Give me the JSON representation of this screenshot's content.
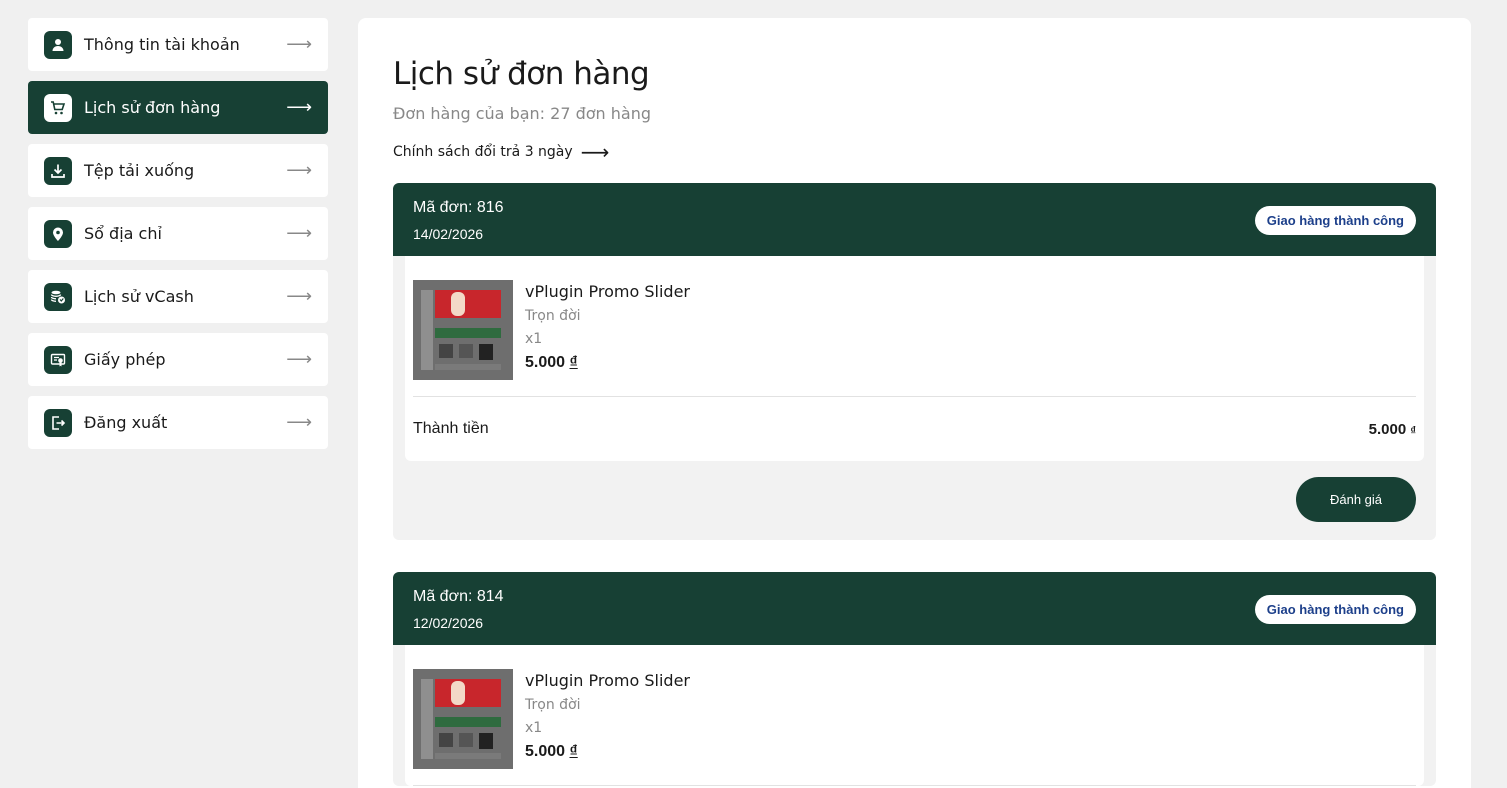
{
  "sidebar": {
    "items": [
      {
        "label": "Thông tin tài khoản",
        "icon": "user-icon",
        "arrow": "⟶"
      },
      {
        "label": "Lịch sử đơn hàng",
        "icon": "cart-icon",
        "arrow": "⟶",
        "active": true
      },
      {
        "label": "Tệp tải xuống",
        "icon": "download-icon",
        "arrow": "⟶"
      },
      {
        "label": "Sổ địa chỉ",
        "icon": "location-pin-icon",
        "arrow": "⟶"
      },
      {
        "label": "Lịch sử vCash",
        "icon": "coins-icon",
        "arrow": "⟶"
      },
      {
        "label": "Giấy phép",
        "icon": "certificate-icon",
        "arrow": "⟶"
      },
      {
        "label": "Đăng xuất",
        "icon": "logout-icon",
        "arrow": "⟶"
      }
    ]
  },
  "main": {
    "title": "Lịch sử đơn hàng",
    "order_count": "Đơn hàng của bạn: 27 đơn hàng",
    "policy_link": "Chính sách đổi trả 3 ngày",
    "policy_arrow": "⟶",
    "orders": [
      {
        "code": "Mã đơn: 816",
        "date": "14/02/2026",
        "status": "Giao hàng thành công",
        "product": {
          "name": "vPlugin Promo Slider",
          "duration": "Trọn đời",
          "qty": "x1",
          "price": "5.000",
          "currency": "₫"
        },
        "total_label": "Thành tiền",
        "total_value": "5.000",
        "total_currency": "₫",
        "review_button": "Đánh giá"
      },
      {
        "code": "Mã đơn: 814",
        "date": "12/02/2026",
        "status": "Giao hàng thành công",
        "product": {
          "name": "vPlugin Promo Slider",
          "duration": "Trọn đời",
          "qty": "x1",
          "price": "5.000",
          "currency": "₫"
        }
      }
    ]
  },
  "colors": {
    "primary": "#174034",
    "status_text": "#1c3f8a",
    "background": "#f0f0f0"
  }
}
